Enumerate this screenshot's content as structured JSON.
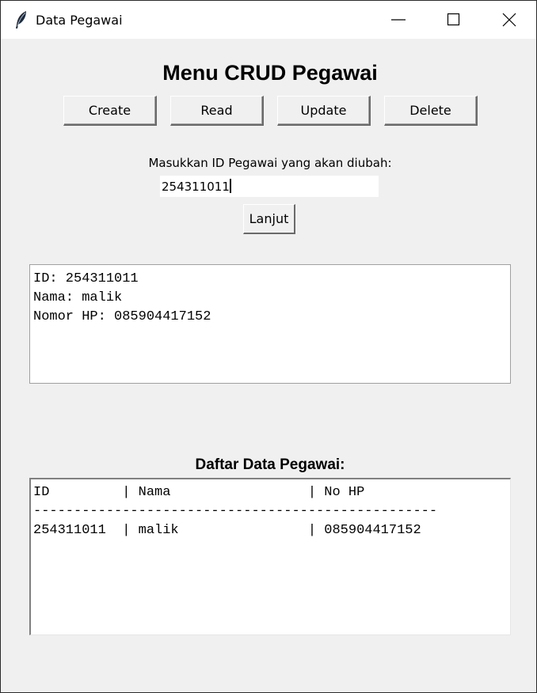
{
  "window": {
    "title": "Data Pegawai"
  },
  "main": {
    "heading": "Menu CRUD Pegawai",
    "buttons": {
      "create": "Create",
      "read": "Read",
      "update": "Update",
      "delete": "Delete"
    },
    "prompt_label": "Masukkan ID Pegawai yang akan diubah:",
    "id_input_value": "254311011",
    "lanjut_label": "Lanjut"
  },
  "result": {
    "lines": [
      "ID: 254311011",
      "Nama: malik",
      "Nomor HP: 085904417152"
    ]
  },
  "list": {
    "title": "Daftar Data Pegawai:",
    "header": "ID         | Nama                 | No HP",
    "separator": "--------------------------------------------------",
    "rows": [
      "254311011  | malik                | 085904417152"
    ]
  }
}
